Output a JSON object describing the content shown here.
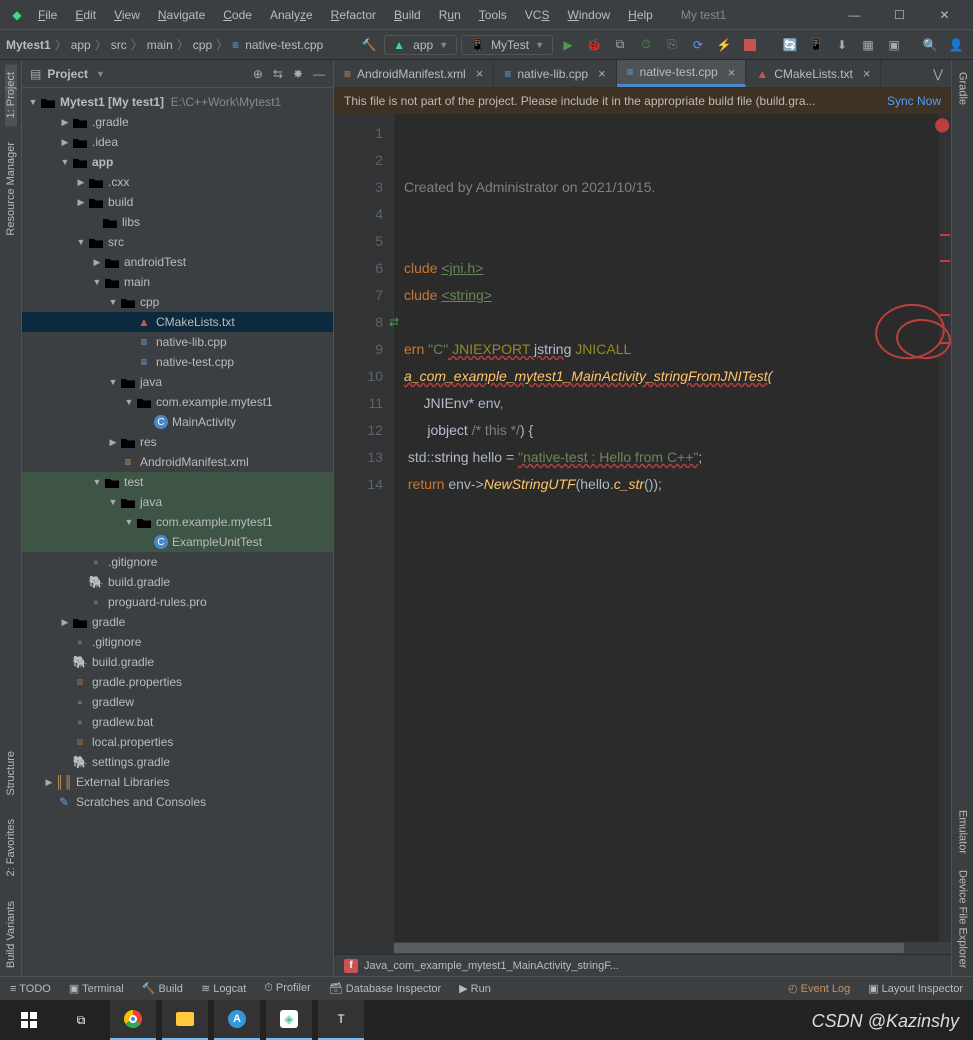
{
  "window": {
    "title": "My test1"
  },
  "menu": [
    "File",
    "Edit",
    "View",
    "Navigate",
    "Code",
    "Analyze",
    "Refactor",
    "Build",
    "Run",
    "Tools",
    "VCS",
    "Window",
    "Help"
  ],
  "winButtons": {
    "min": "—",
    "max": "▢",
    "close": "✕"
  },
  "breadcrumb": [
    "Mytest1",
    "app",
    "src",
    "main",
    "cpp",
    "native-test.cpp"
  ],
  "runConfigs": {
    "app": "app",
    "device": "MyTest"
  },
  "panel": {
    "title": "Project"
  },
  "tree": {
    "root": {
      "name": "Mytest1",
      "tag": "[My test1]",
      "path": "E:\\C++Work\\Mytest1"
    },
    "items": [
      ".gradle",
      ".idea",
      "app",
      ".cxx",
      "build",
      "libs",
      "src",
      "androidTest",
      "main",
      "cpp",
      "CMakeLists.txt",
      "native-lib.cpp",
      "native-test.cpp",
      "java",
      "com.example.mytest1",
      "MainActivity",
      "res",
      "AndroidManifest.xml",
      "test",
      "java",
      "com.example.mytest1",
      "ExampleUnitTest",
      ".gitignore",
      "build.gradle",
      "proguard-rules.pro",
      "gradle",
      ".gitignore",
      "build.gradle",
      "gradle.properties",
      "gradlew",
      "gradlew.bat",
      "local.properties",
      "settings.gradle",
      "External Libraries",
      "Scratches and Consoles"
    ]
  },
  "tabs": [
    {
      "label": "AndroidManifest.xml",
      "icon": "xml"
    },
    {
      "label": "native-lib.cpp",
      "icon": "cpp"
    },
    {
      "label": "native-test.cpp",
      "icon": "cpp",
      "active": true
    },
    {
      "label": "CMakeLists.txt",
      "icon": "cmake"
    }
  ],
  "banner": {
    "text": "This file is not part of the project. Please include it in the appropriate build file (build.gra...",
    "action": "Sync Now"
  },
  "code": {
    "lines": 14,
    "l2": "Created by Administrator on 2021/10/15.",
    "l5a": "clude ",
    "l5b": "<jni.h>",
    "l6a": "clude ",
    "l6b": "<string>",
    "l8a": "ern ",
    "l8b": "\"C\"",
    "l8c": " JNIEXPORT ",
    "l8d": "jstring",
    "l8e": " JNICALL",
    "l9": "a_com_example_mytest1_MainActivity_stringFromJNITest(",
    "l10a": "JNIEnv* ",
    "l10b": "env",
    "l11a": "jobject ",
    "l11b": "/* this */",
    "l11c": ") {",
    "l12a": "std::",
    "l12b": "string ",
    "l12c": "hello = ",
    "l12d": "\"native-test : Hello from C++\"",
    "l12e": ";",
    "l13a": "return ",
    "l13b": "env->",
    "l13c": "NewStringUTF",
    "l13d": "(hello.",
    "l13e": "c_str",
    "l13f": "());"
  },
  "bottomBreadcrumb": {
    "icon": "f",
    "text": "Java_com_example_mytest1_MainActivity_stringF..."
  },
  "statusbar": [
    "TODO",
    "Terminal",
    "Build",
    "Logcat",
    "Profiler",
    "Database Inspector",
    "Run"
  ],
  "statusbarRight": [
    "Event Log",
    "Layout Inspector"
  ],
  "sideTools": {
    "left": [
      "1: Project",
      "Resource Manager",
      "Structure",
      "2: Favorites",
      "Build Variants"
    ],
    "right": [
      "Gradle",
      "Emulator",
      "Device File Explorer"
    ]
  },
  "watermark": "CSDN @Kazinshy"
}
